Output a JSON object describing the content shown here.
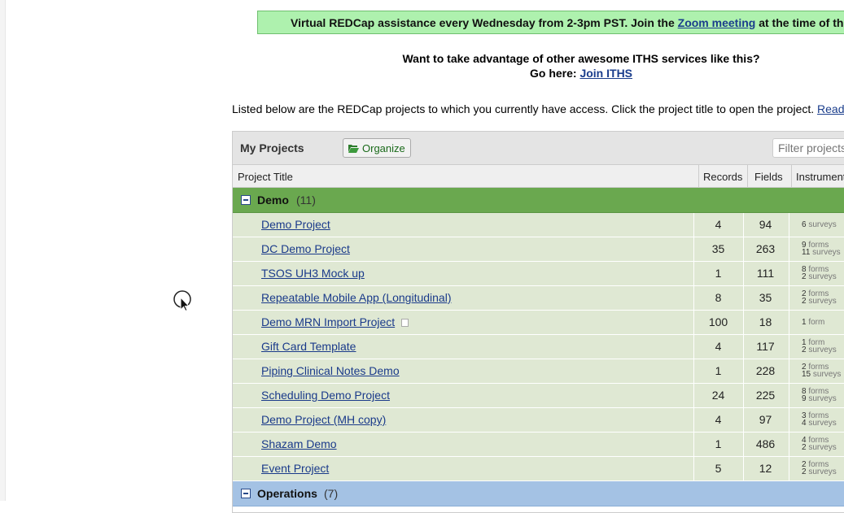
{
  "banner": {
    "text_before": "Virtual REDCap assistance every Wednesday from 2-3pm PST. Join the ",
    "link": "Zoom meeting",
    "text_after": " at the time of the meeting"
  },
  "promo": {
    "line1": "Want to take advantage of other awesome ITHS services like this?",
    "line2_prefix": "Go here: ",
    "line2_link": "Join ITHS"
  },
  "intro": {
    "text": "Listed below are the REDCap projects to which you currently have access. Click the project title to open the project. ",
    "link": "Read more"
  },
  "my_projects": {
    "title": "My Projects",
    "organize_label": "Organize",
    "filter_placeholder": "Filter projects"
  },
  "columns": {
    "title": "Project Title",
    "records": "Records",
    "fields": "Fields",
    "instruments": "Instruments"
  },
  "folders": [
    {
      "name": "Demo",
      "count": "(11)"
    },
    {
      "name": "Operations",
      "count": "(7)"
    }
  ],
  "projects": [
    {
      "title": "Demo Project",
      "records": "4",
      "fields": "94",
      "ins1_n": "6",
      "ins1_t": "surveys",
      "ins2_n": "",
      "ins2_t": ""
    },
    {
      "title": "DC Demo Project",
      "records": "35",
      "fields": "263",
      "ins1_n": "9",
      "ins1_t": "forms",
      "ins2_n": "11",
      "ins2_t": "surveys"
    },
    {
      "title": "TSOS UH3 Mock up",
      "records": "1",
      "fields": "111",
      "ins1_n": "8",
      "ins1_t": "forms",
      "ins2_n": "2",
      "ins2_t": "surveys"
    },
    {
      "title": "Repeatable Mobile App (Longitudinal)",
      "records": "8",
      "fields": "35",
      "ins1_n": "2",
      "ins1_t": "forms",
      "ins2_n": "2",
      "ins2_t": "surveys"
    },
    {
      "title": "Demo MRN Import Project",
      "records": "100",
      "fields": "18",
      "ins1_n": "1",
      "ins1_t": "form",
      "ins2_n": "",
      "ins2_t": ""
    },
    {
      "title": "Gift Card Template",
      "records": "4",
      "fields": "117",
      "ins1_n": "1",
      "ins1_t": "form",
      "ins2_n": "2",
      "ins2_t": "surveys"
    },
    {
      "title": "Piping Clinical Notes Demo",
      "records": "1",
      "fields": "228",
      "ins1_n": "2",
      "ins1_t": "forms",
      "ins2_n": "15",
      "ins2_t": "surveys"
    },
    {
      "title": "Scheduling Demo Project",
      "records": "24",
      "fields": "225",
      "ins1_n": "8",
      "ins1_t": "forms",
      "ins2_n": "9",
      "ins2_t": "surveys"
    },
    {
      "title": "Demo Project (MH copy)",
      "records": "4",
      "fields": "97",
      "ins1_n": "3",
      "ins1_t": "forms",
      "ins2_n": "4",
      "ins2_t": "surveys"
    },
    {
      "title": "Shazam Demo",
      "records": "1",
      "fields": "486",
      "ins1_n": "4",
      "ins1_t": "forms",
      "ins2_n": "2",
      "ins2_t": "surveys"
    },
    {
      "title": "Event Project",
      "records": "5",
      "fields": "12",
      "ins1_n": "2",
      "ins1_t": "forms",
      "ins2_n": "2",
      "ins2_t": "surveys"
    }
  ],
  "icons": {
    "folder": "folder-open-icon",
    "toggle": "collapse-minus-icon",
    "doc": "document-icon",
    "cursor": "mouse-cursor-icon"
  }
}
